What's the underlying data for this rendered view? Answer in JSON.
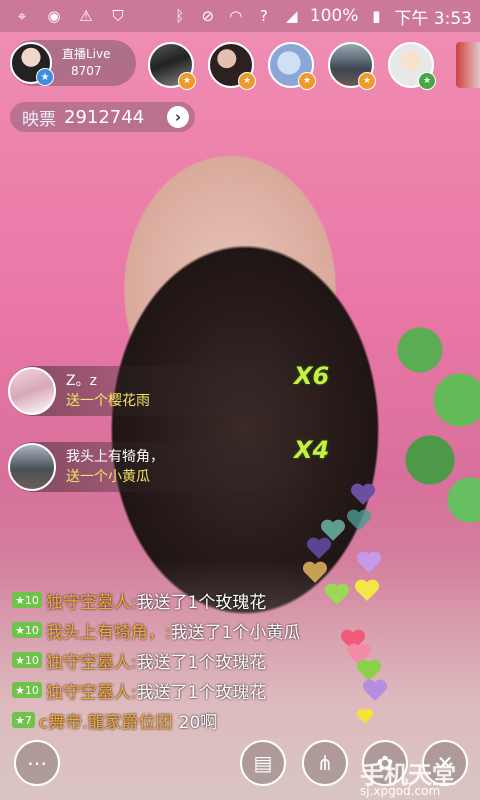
{
  "statusbar": {
    "battery": "100%",
    "time": "下午 3:53",
    "icons": [
      "crosshair-icon",
      "chat-bubble-icon",
      "warning-icon",
      "shield-icon",
      "bluetooth-icon",
      "mute-icon",
      "wifi-icon",
      "sim-icon",
      "signal-icon",
      "battery-icon"
    ]
  },
  "host": {
    "title": "直播Live",
    "count": "8707"
  },
  "viewers": [
    {
      "name": "viewer-1",
      "level_color": "#f09a2a"
    },
    {
      "name": "viewer-2",
      "level_color": "#f09a2a"
    },
    {
      "name": "viewer-3",
      "level_color": "#f09a2a"
    },
    {
      "name": "viewer-4",
      "level_color": "#f09a2a"
    },
    {
      "name": "viewer-5",
      "level_color": "#44a842"
    }
  ],
  "ticket": {
    "label": "映票",
    "value": "2912744"
  },
  "gifts": [
    {
      "user": "Z。z",
      "message": "送一个樱花雨",
      "combo": "X6"
    },
    {
      "user": "我头上有犄角，",
      "message": "送一个小黄瓜",
      "combo": "X4"
    }
  ],
  "chat": [
    {
      "level": "10",
      "name": "独守空墓人:",
      "text": "我送了1个玫瑰花"
    },
    {
      "level": "10",
      "name": "我头上有犄角，:",
      "text": "我送了1个小黄瓜"
    },
    {
      "level": "10",
      "name": "独守空墓人:",
      "text": "我送了1个玫瑰花"
    },
    {
      "level": "10",
      "name": "独守空墓人:",
      "text": "我送了1个玫瑰花"
    },
    {
      "level": "7",
      "name": "c舞帝.龍家爵位团",
      "text": "20啊"
    }
  ],
  "watermark": {
    "brand": "手机天堂",
    "url": "sj.xpgod.com"
  },
  "colors": {
    "level_badge": "#6ec34a",
    "chat_name": "#f6a93a",
    "combo": "#c8f040"
  }
}
